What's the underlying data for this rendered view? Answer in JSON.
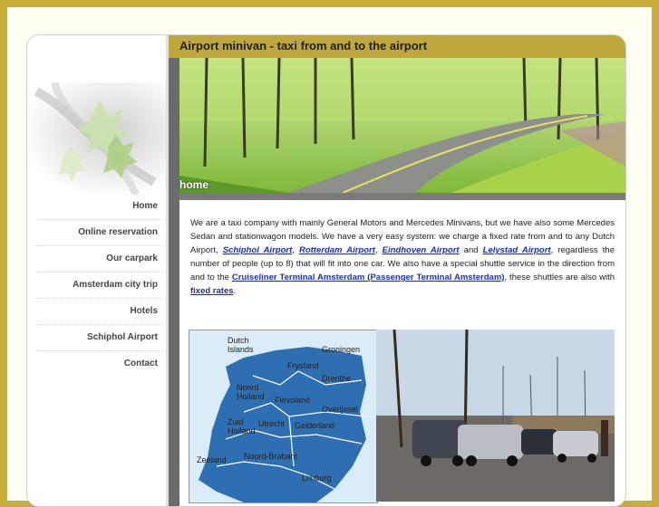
{
  "page": {
    "title": "Airport minivan - taxi from and to the airport",
    "banner_tag": "home"
  },
  "nav": {
    "items": [
      {
        "label": "Home"
      },
      {
        "label": "Online reservation"
      },
      {
        "label": "Our carpark"
      },
      {
        "label": "Amsterdam city trip"
      },
      {
        "label": "Hotels"
      },
      {
        "label": "Schiphol Airport"
      },
      {
        "label": "Contact"
      }
    ]
  },
  "content": {
    "p1_start": "We are a taxi company with mainly General Motors and Mercedes Minivans, but we have also some Mercedes Sedan and stationwagon models. We have a very easy system: we charge a fixed rate from and to any Dutch Airport, ",
    "link_schiphol": "Schiphol Airport",
    "sep1": ", ",
    "link_rotterdam": "Rotterdam Airport",
    "sep2": ", ",
    "link_eindhoven": "Eindhoven Airport",
    "sep3": " and ",
    "link_lelystad": "Lelystad Airport",
    "p1_mid": ", regardless the number of people (up to 8) that will fit into one car. We also have a special shuttle service in the direction from and to the ",
    "link_cruise": "Cruiseliner Terminal Amsterdam (Passenger Terminal Amsterdam)",
    "p1_mid2": ", these shuttles are also with ",
    "link_fixed": "fixed rates",
    "p1_end": "."
  },
  "map": {
    "labels": [
      {
        "text": "Dutch Islands"
      },
      {
        "text": "Groningen"
      },
      {
        "text": "Frysland"
      },
      {
        "text": "Drenthe"
      },
      {
        "text": "Noord Holland"
      },
      {
        "text": "Flevoland"
      },
      {
        "text": "Overijssel"
      },
      {
        "text": "Zuid Holland"
      },
      {
        "text": "Utrecht"
      },
      {
        "text": "Gelderland"
      },
      {
        "text": "Noord-Brabant"
      },
      {
        "text": "Zeeland"
      },
      {
        "text": "Limburg"
      }
    ]
  },
  "colors": {
    "outer_bg": "#c8ad3a",
    "title_bar": "#bfa73b",
    "link": "#1b2fb0",
    "map_land": "#2e6fb3"
  }
}
